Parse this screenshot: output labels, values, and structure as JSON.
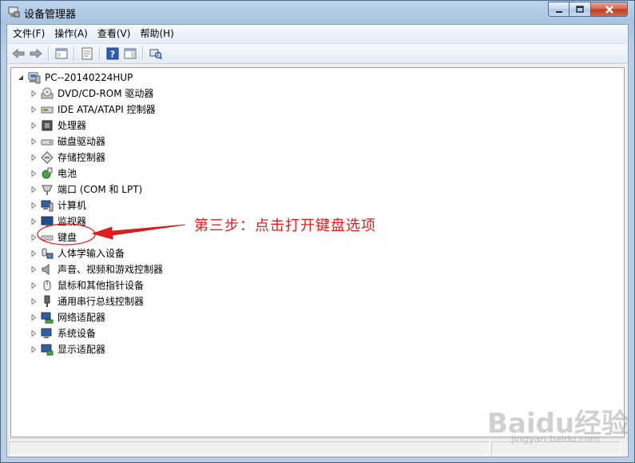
{
  "window": {
    "title": "设备管理器"
  },
  "menu": [
    {
      "label": "文件(F)",
      "name": "menu-file"
    },
    {
      "label": "操作(A)",
      "name": "menu-action"
    },
    {
      "label": "查看(V)",
      "name": "menu-view"
    },
    {
      "label": "帮助(H)",
      "name": "menu-help"
    }
  ],
  "toolbar": {
    "icons": [
      "back-arrow-icon",
      "forward-arrow-icon",
      "show-hide-tree-icon",
      "properties-icon",
      "help-icon",
      "action-pane-icon",
      "scan-hardware-icon"
    ]
  },
  "tree": {
    "root": {
      "label": "PC--20140224HUP",
      "icon": "computer-icon"
    },
    "items": [
      {
        "label": "DVD/CD-ROM 驱动器",
        "icon": "dvd-drive-icon"
      },
      {
        "label": "IDE ATA/ATAPI 控制器",
        "icon": "ide-controller-icon"
      },
      {
        "label": "处理器",
        "icon": "processor-icon"
      },
      {
        "label": "磁盘驱动器",
        "icon": "disk-drive-icon"
      },
      {
        "label": "存储控制器",
        "icon": "storage-controller-icon"
      },
      {
        "label": "电池",
        "icon": "battery-icon"
      },
      {
        "label": "端口 (COM 和 LPT)",
        "icon": "port-icon"
      },
      {
        "label": "计算机",
        "icon": "computer-icon"
      },
      {
        "label": "监视器",
        "icon": "monitor-icon"
      },
      {
        "label": "键盘",
        "icon": "keyboard-icon"
      },
      {
        "label": "人体学输入设备",
        "icon": "hid-icon"
      },
      {
        "label": "声音、视频和游戏控制器",
        "icon": "sound-icon"
      },
      {
        "label": "鼠标和其他指针设备",
        "icon": "mouse-icon"
      },
      {
        "label": "通用串行总线控制器",
        "icon": "usb-icon"
      },
      {
        "label": "网络适配器",
        "icon": "network-adapter-icon"
      },
      {
        "label": "系统设备",
        "icon": "system-device-icon"
      },
      {
        "label": "显示适配器",
        "icon": "display-adapter-icon"
      }
    ]
  },
  "annotation": {
    "text": "第三步：点击打开键盘选项",
    "color": "#e31c1c"
  },
  "watermark": {
    "logo": "Baidu经验",
    "url": "jingyan.baidu.com"
  }
}
